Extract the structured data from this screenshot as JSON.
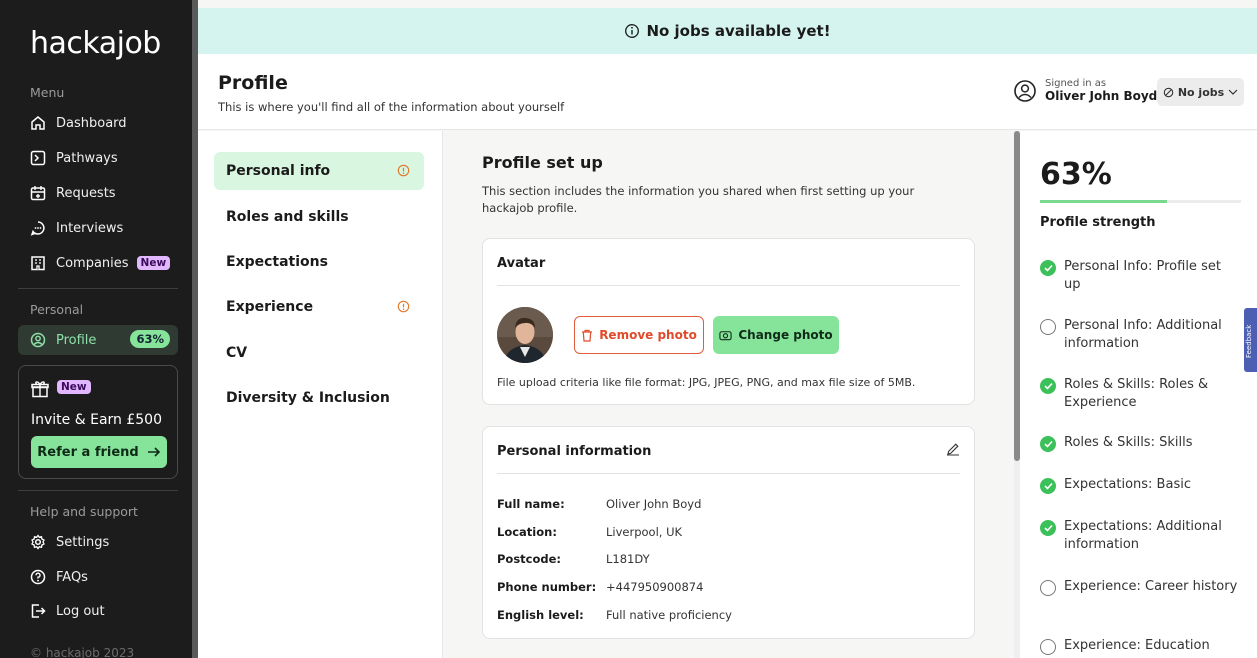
{
  "brand": {
    "logo": "hackajob",
    "copyright": "© hackajob 2023"
  },
  "sidebar": {
    "menu_label": "Menu",
    "items": [
      {
        "label": "Dashboard",
        "icon": "home-icon"
      },
      {
        "label": "Pathways",
        "icon": "terminal-icon"
      },
      {
        "label": "Requests",
        "icon": "calendar-plus-icon"
      },
      {
        "label": "Interviews",
        "icon": "chat-icon"
      },
      {
        "label": "Companies",
        "icon": "building-icon",
        "badge": "New"
      }
    ],
    "personal_label": "Personal",
    "profile": {
      "label": "Profile",
      "pill": "63%"
    },
    "invite": {
      "badge": "New",
      "title": "Invite & Earn £500",
      "button": "Refer a friend"
    },
    "help_label": "Help and support",
    "help_items": [
      {
        "label": "Settings"
      },
      {
        "label": "FAQs"
      },
      {
        "label": "Log out"
      }
    ]
  },
  "banner": {
    "text": "No jobs available yet!"
  },
  "header": {
    "title": "Profile",
    "subtitle": "This is where you'll find all of the information about yourself",
    "signed_in_label": "Signed in as",
    "user_name": "Oliver John Boyd",
    "jobs_status": "No jobs"
  },
  "profile_menu": [
    {
      "label": "Personal info",
      "active": true,
      "warning": true
    },
    {
      "label": "Roles and skills"
    },
    {
      "label": "Expectations"
    },
    {
      "label": "Experience",
      "warning": true
    },
    {
      "label": "CV"
    },
    {
      "label": "Diversity & Inclusion"
    }
  ],
  "section": {
    "title": "Profile set up",
    "description": "This section includes the information you shared when first setting up your hackajob profile."
  },
  "avatar_card": {
    "title": "Avatar",
    "remove_label": "Remove photo",
    "change_label": "Change photo",
    "upload_note": "File upload criteria like file format: JPG, JPEG, PNG, and max file size of 5MB."
  },
  "personal_card": {
    "title": "Personal information",
    "fields": [
      {
        "key": "Full name:",
        "value": "Oliver John Boyd"
      },
      {
        "key": "Location:",
        "value": "Liverpool, UK"
      },
      {
        "key": "Postcode:",
        "value": "L181DY"
      },
      {
        "key": "Phone number:",
        "value": "+447950900874"
      },
      {
        "key": "English level:",
        "value": "Full native proficiency"
      }
    ]
  },
  "strength": {
    "percent_text": "63%",
    "percent": 0.63,
    "label": "Profile strength",
    "items": [
      {
        "label": "Personal Info: Profile set up",
        "done": true
      },
      {
        "label": "Personal Info: Additional information",
        "done": false
      },
      {
        "label": "Roles & Skills: Roles & Experience",
        "done": true
      },
      {
        "label": "Roles & Skills: Skills",
        "done": true
      },
      {
        "label": "Expectations: Basic",
        "done": true
      },
      {
        "label": "Expectations: Additional information",
        "done": true
      },
      {
        "label": "Experience: Career history",
        "done": false
      },
      {
        "label": "Experience: Education",
        "done": false
      }
    ]
  },
  "feedback": {
    "label": "Feedback"
  },
  "colors": {
    "accent_green": "#86e39a",
    "banner_bg": "#d6f4ef",
    "warning": "#e0772a",
    "danger": "#e04b2a",
    "feedback_tab": "#4c5fb3"
  }
}
